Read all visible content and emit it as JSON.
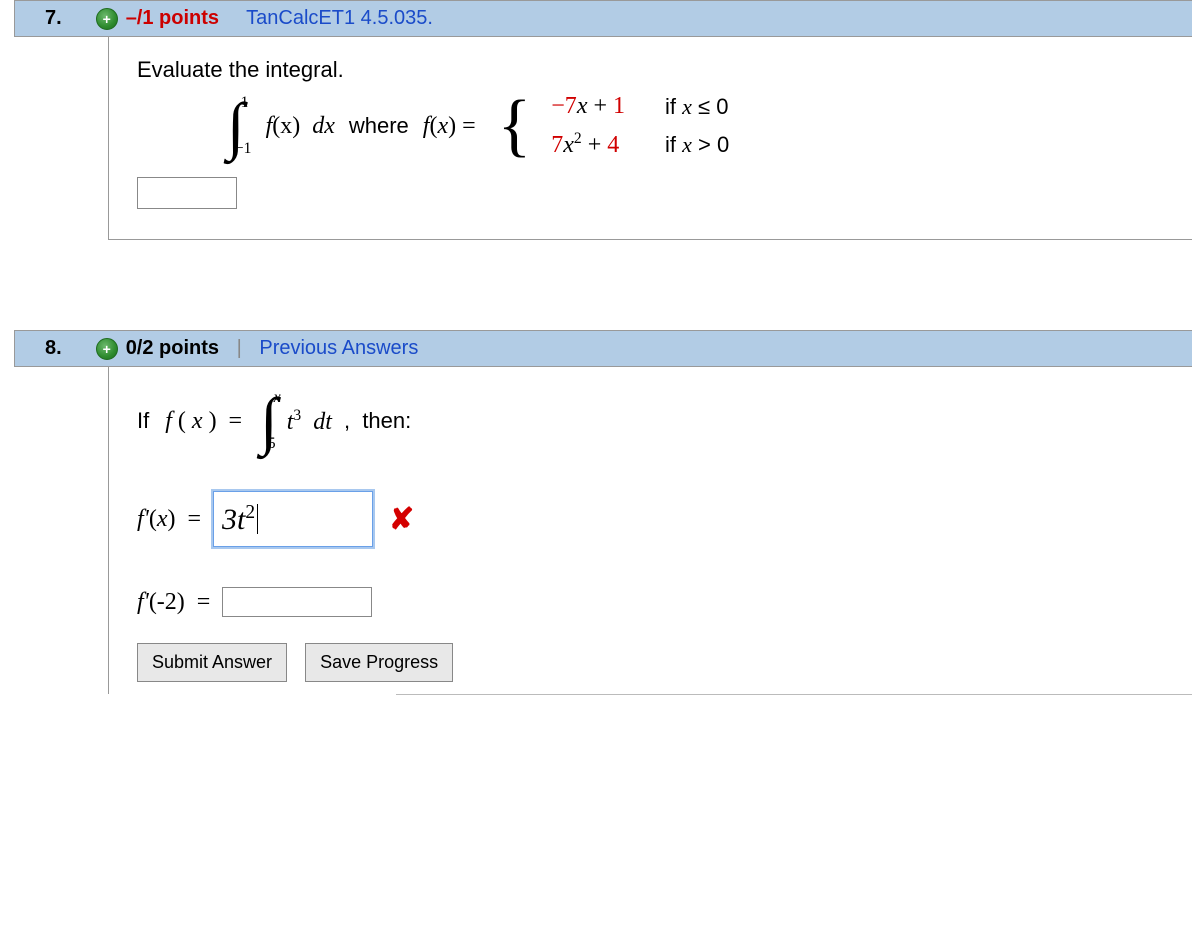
{
  "q7": {
    "number": "7.",
    "points_prefix": "–/1 points",
    "source": "TanCalcET1 4.5.035.",
    "prompt": "Evaluate the integral.",
    "integral": {
      "upper": "1",
      "lower": "−1",
      "integrand_prefix": "f",
      "integrand_var": "(x)",
      "dx": "dx",
      "where_text": "where",
      "fx_label": "f(x) ="
    },
    "pieces": [
      {
        "coef": "−7",
        "var": "x",
        "plus": " + ",
        "const": "1",
        "cond": "if x ≤ 0"
      },
      {
        "coef": "7",
        "var": "x",
        "exp": "2",
        "plus": " + ",
        "const": "4",
        "cond": "if x > 0"
      }
    ],
    "answer_value": ""
  },
  "q8": {
    "number": "8.",
    "points": "0/2 points",
    "prev_link": "Previous Answers",
    "if_text": "If ",
    "fx_eq": "f(x) = ",
    "integral": {
      "upper": "x",
      "lower": "5",
      "integrand": "t",
      "exp": "3",
      "dt": "dt"
    },
    "then_text": ", then:",
    "fprime_label": "f'(x) = ",
    "fprime_value": "3t",
    "fprime_exp": "2",
    "fpneg2_label": "f'(-2) = ",
    "fpneg2_value": "",
    "submit_label": "Submit Answer",
    "save_label": "Save Progress"
  }
}
